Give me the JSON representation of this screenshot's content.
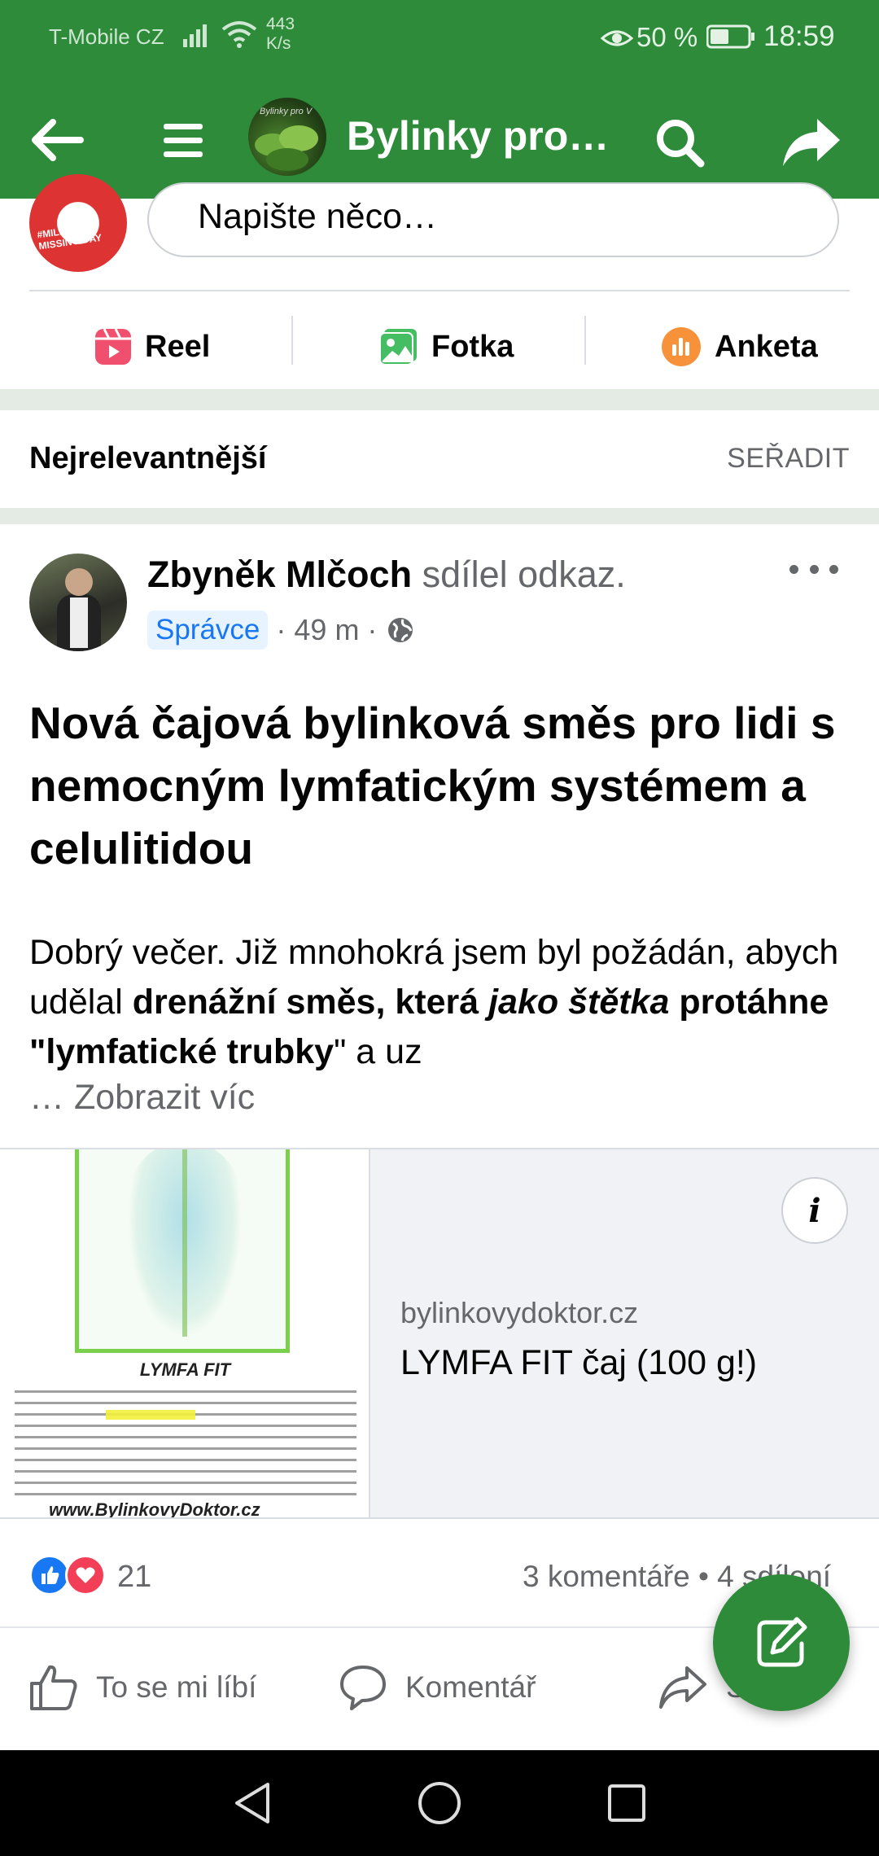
{
  "status_bar": {
    "carrier": "T-Mobile CZ",
    "speed_value": "443",
    "speed_unit": "K/s",
    "battery": "50 %",
    "time": "18:59",
    "battery_level": 0.5
  },
  "app_bar": {
    "group_title": "Bylinky pro…",
    "avatar_text": "Bylinky pro V"
  },
  "composer": {
    "placeholder": "Napište něco…",
    "avatar_text": "#MILLIONS MISSING DAY",
    "actions": {
      "reel": "Reel",
      "photo": "Fotka",
      "poll": "Anketa"
    }
  },
  "sort": {
    "label": "Nejrelevantnější",
    "button": "SEŘADIT"
  },
  "post": {
    "author": "Zbyněk Mlčoch",
    "action": " sdílel odkaz.",
    "badge": "Správce",
    "time": " · 49 m · ",
    "title": "Nová čajová bylinková směs pro lidi s nemocným lymfatickým systémem a celulitidou",
    "body": {
      "t1": "Dobrý večer. Již mnohokrá jsem byl požádán, abych udělal ",
      "b1": "drenážní směs, která ",
      "bi1": "jako štětka",
      "b2": "protáhne \"lymfatické trubky",
      "t2": "\" a uz"
    },
    "see_more": "… Zobrazit víc",
    "link": {
      "thumb_label": "LYMFA FIT",
      "thumb_site": "www.BylinkovyDoktor.cz",
      "domain": "bylinkovydoktor.cz",
      "title": "LYMFA FIT čaj (100 g!)"
    },
    "reactions": {
      "count": "21",
      "stats": "3 komentáře • 4 sdílení"
    },
    "buttons": {
      "like": "To se mi líbí",
      "comment": "Komentář",
      "share": "Sdílet"
    }
  },
  "colors": {
    "brand_green": "#2e8b3a",
    "link_blue": "#1877f2",
    "muted": "#65676b"
  }
}
